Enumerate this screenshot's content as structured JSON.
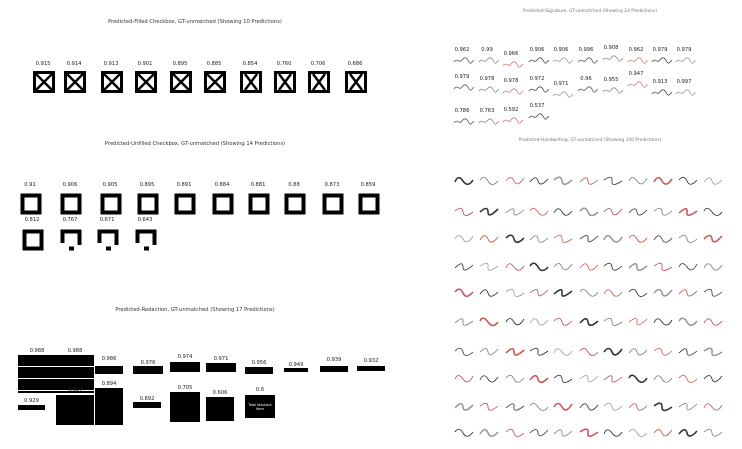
{
  "panels": {
    "filled": {
      "title": "Predicted-Filled Checkbox, GT-unmatched (Showing 10 Predictions)",
      "scores": [
        "0.915",
        "0.914",
        "0.913",
        "0.901",
        "0.895",
        "0.885",
        "0.854",
        "0.760",
        "0.706",
        "0.686"
      ]
    },
    "unfilled": {
      "title": "Predicted-Unfilled Checkbox, GT-unmatched (Showing 14 Predictions)",
      "scores": [
        "0.91",
        "0.906",
        "0.905",
        "0.895",
        "0.891",
        "0.884",
        "0.881",
        "0.88",
        "0.873",
        "0.859",
        "0.812",
        "0.767",
        "0.671",
        "0.643"
      ]
    },
    "redaction": {
      "title": "Predicted-Redaction, GT-unmatched (Showing 17 Predictions)",
      "scores": [
        "0.988",
        "0.988",
        "0.986",
        "0.976",
        "0.974",
        "0.971",
        "0.956",
        "0.949",
        "0.939",
        "0.932",
        "0.929",
        "0.927",
        "0.894",
        "0.892",
        "0.705",
        "0.606",
        "0.6"
      ],
      "last_text": "Total blackout item"
    },
    "signature": {
      "title": "Predicted-Signature, GT-unmatched (Showing 24 Predictions)",
      "scores": [
        "0.962",
        "0.99",
        "0.966",
        "0.906",
        "0.906",
        "0.996",
        "0.908",
        "0.962",
        "0.979",
        "0.979",
        "0.979",
        "0.978",
        "0.978",
        "0.972",
        "0.971",
        "0.96",
        "0.955",
        "0.947",
        "0.913",
        "0.997",
        "0.786",
        "0.763",
        "0.592",
        "0.537"
      ]
    },
    "handwriting": {
      "title": "Predicted-Handwriting, GT-unmatched (Showing 100 Predictions)"
    }
  }
}
